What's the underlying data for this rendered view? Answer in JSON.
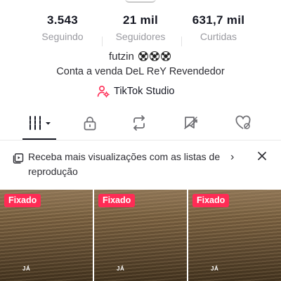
{
  "stats": {
    "following": {
      "value": "3.543",
      "label": "Seguindo"
    },
    "followers": {
      "value": "21 mil",
      "label": "Seguidores"
    },
    "likes": {
      "value": "631,7 mil",
      "label": "Curtidas"
    }
  },
  "bio": {
    "name": "futzin",
    "name_icons": [
      "soccer-ball-icon",
      "soccer-ball-icon",
      "soccer-ball-icon"
    ],
    "line": "Conta a venda DeL ReY Revendedor"
  },
  "studio_link": {
    "label": "TikTok Studio",
    "icon": "person-settings-icon",
    "color": "#fe2c55"
  },
  "tabs": [
    {
      "id": "videos",
      "icon": "videos-grid-icon",
      "active": true
    },
    {
      "id": "private",
      "icon": "lock-icon"
    },
    {
      "id": "reposts",
      "icon": "repost-icon"
    },
    {
      "id": "favorites",
      "icon": "favorites-icon"
    },
    {
      "id": "liked",
      "icon": "liked-hidden-icon"
    }
  ],
  "banner": {
    "text": "Receba mais visualizações com as listas de reprodução",
    "icon": "playlist-icon"
  },
  "videos": [
    {
      "badge": "Fixado",
      "caption": "JÁ"
    },
    {
      "badge": "Fixado",
      "caption": "JÁ"
    },
    {
      "badge": "Fixado",
      "caption": "JÁ"
    }
  ],
  "colors": {
    "accent": "#fe2c55",
    "text": "#161823",
    "muted": "#9a9aa0"
  }
}
